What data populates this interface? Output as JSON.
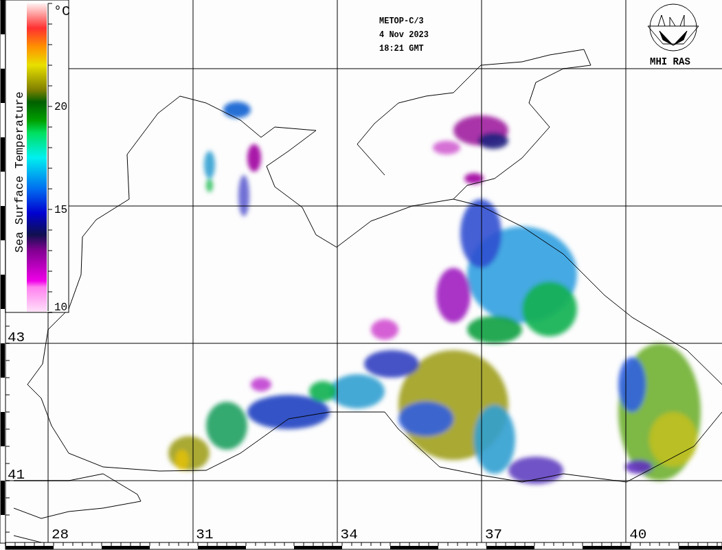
{
  "colorbar": {
    "unit": "°C",
    "title": "Sea Surface Temperature",
    "ticks": [
      "20",
      "15",
      "10"
    ]
  },
  "header": {
    "satellite": "METOP-C/3",
    "date": "4 Nov 2023",
    "time": "18:21 GMT"
  },
  "logo": {
    "text": "MHI RAS"
  },
  "latitude_labels": [
    "43",
    "41"
  ],
  "longitude_labels": [
    "28",
    "31",
    "34",
    "37",
    "40"
  ]
}
